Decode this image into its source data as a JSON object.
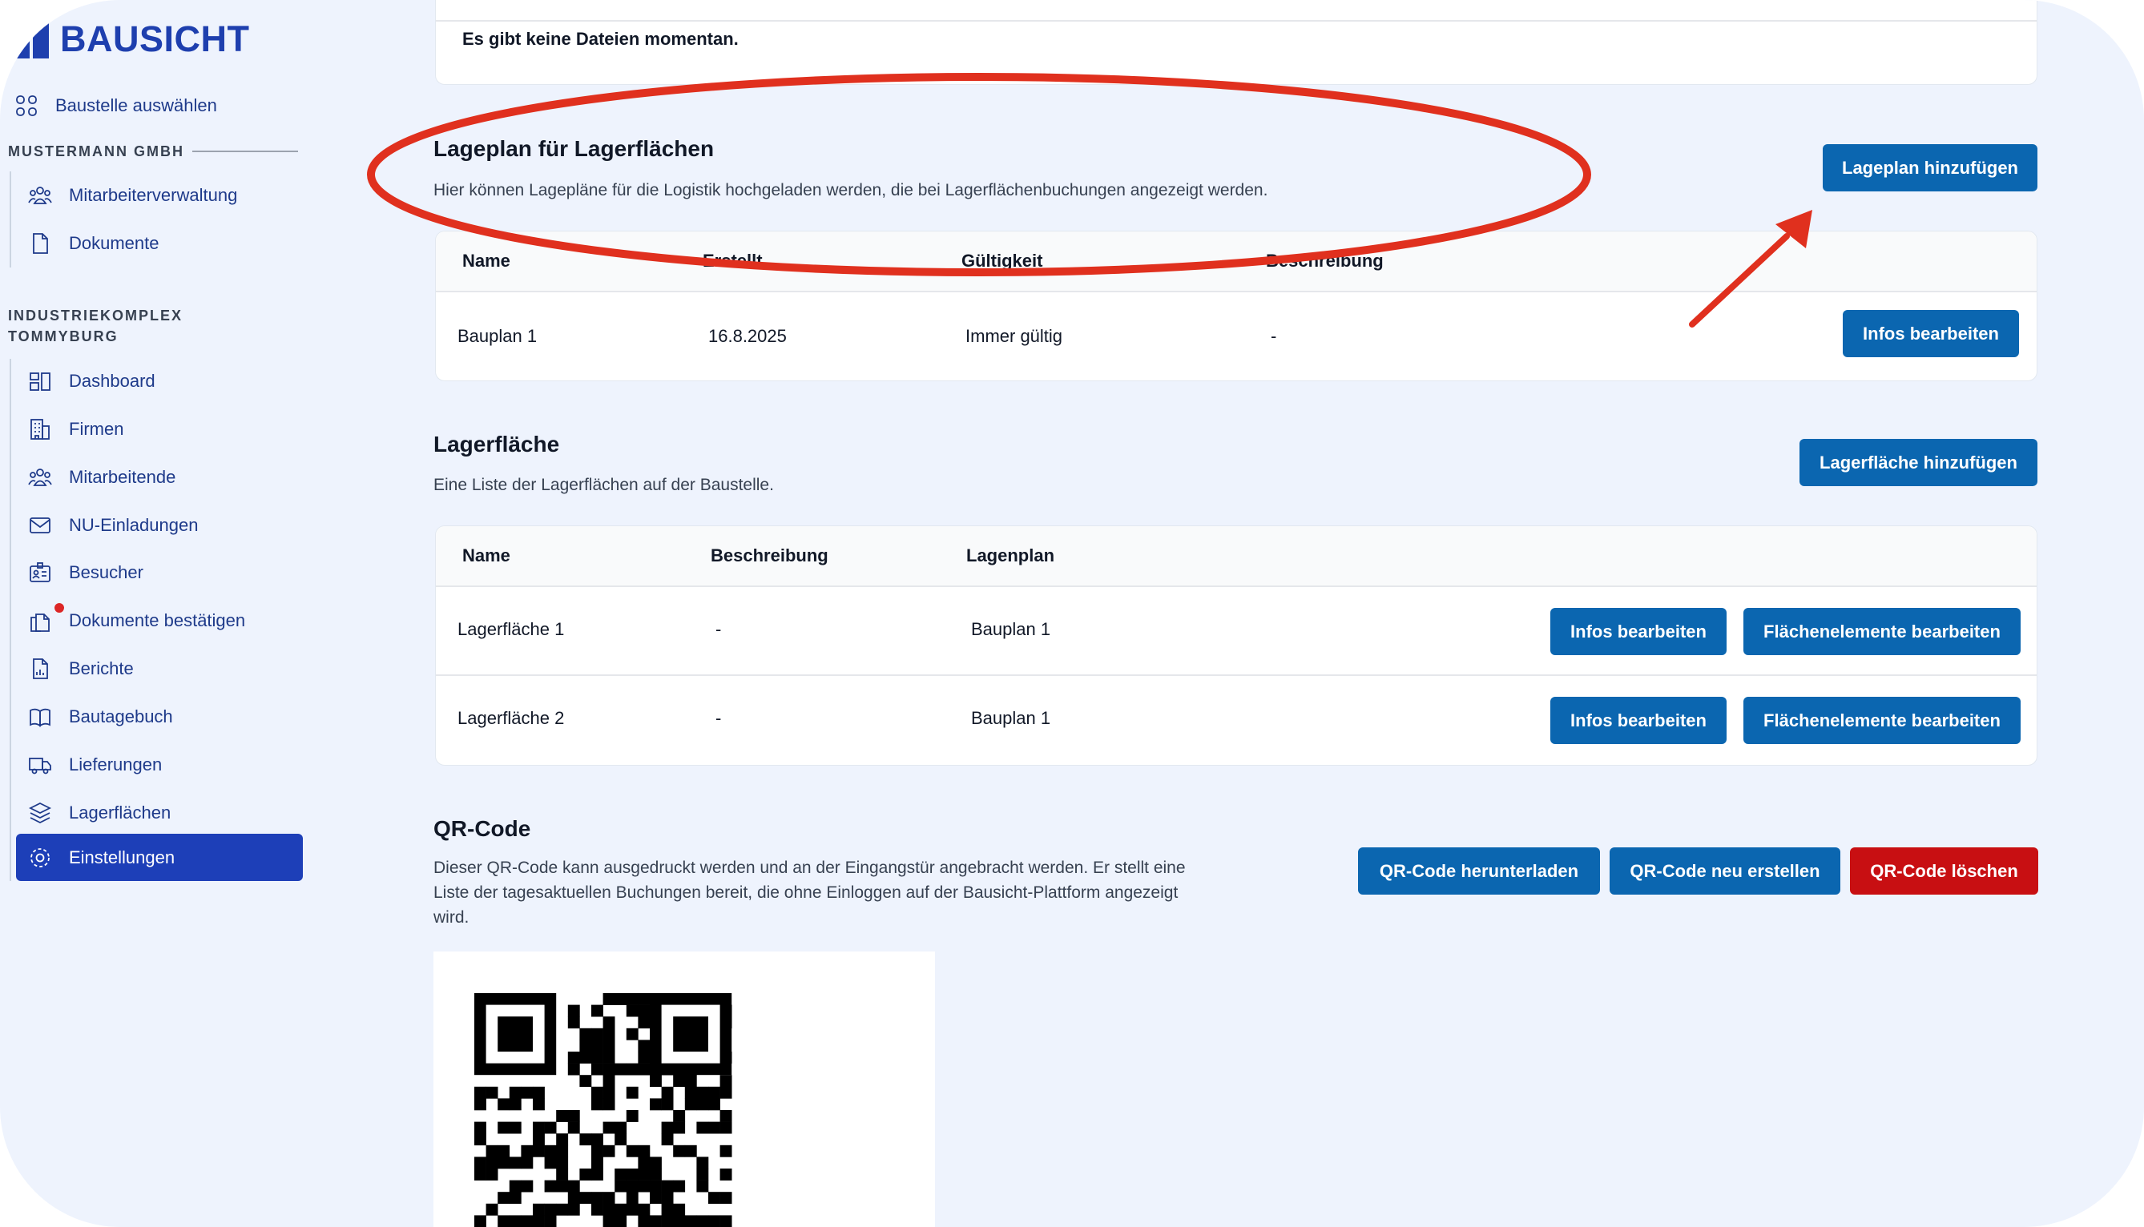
{
  "brand": {
    "name": "BAUSICHT",
    "color": "#1e3fae"
  },
  "sidebar": {
    "choose_site": {
      "label": "Baustelle auswählen",
      "icon": "grid-icon"
    },
    "org_label": "MUSTERMANN GMBH",
    "org_items": [
      {
        "label": "Mitarbeiterverwaltung",
        "icon": "users-icon"
      },
      {
        "label": "Dokumente",
        "icon": "document-icon"
      }
    ],
    "site_label_line1": "INDUSTRIEKOMPLEX",
    "site_label_line2": "TOMMYBURG",
    "site_items": [
      {
        "label": "Dashboard",
        "icon": "dashboard-icon"
      },
      {
        "label": "Firmen",
        "icon": "building-icon"
      },
      {
        "label": "Mitarbeitende",
        "icon": "users-icon"
      },
      {
        "label": "NU-Einladungen",
        "icon": "mail-icon"
      },
      {
        "label": "Besucher",
        "icon": "id-badge-icon"
      },
      {
        "label": "Dokumente bestätigen",
        "icon": "documents-icon"
      },
      {
        "label": "Berichte",
        "icon": "report-icon"
      },
      {
        "label": "Bautagebuch",
        "icon": "book-icon"
      },
      {
        "label": "Lieferungen",
        "icon": "truck-icon"
      },
      {
        "label": "Lagerflächen",
        "icon": "layers-icon"
      },
      {
        "label": "Einstellungen",
        "icon": "gear-icon",
        "active": true
      }
    ]
  },
  "files_card": {
    "empty_text": "Es gibt keine Dateien momentan."
  },
  "lageplan": {
    "title": "Lageplan für Lagerflächen",
    "description": "Hier können Lagepläne für die Logistik hochgeladen werden, die bei Lagerflächenbuchungen angezeigt werden.",
    "add_button": "Lageplan hinzufügen",
    "columns": [
      "Name",
      "Erstellt",
      "Gültigkeit",
      "Beschreibung"
    ],
    "rows": [
      {
        "name": "Bauplan 1",
        "created": "16.8.2025",
        "validity": "Immer gültig",
        "description": "-",
        "edit_button": "Infos bearbeiten"
      }
    ]
  },
  "lagerflaeche": {
    "title": "Lagerfläche",
    "description": "Eine Liste der Lagerflächen auf der Baustelle.",
    "add_button": "Lagerfläche hinzufügen",
    "columns": [
      "Name",
      "Beschreibung",
      "Lagenplan"
    ],
    "rows": [
      {
        "name": "Lagerfläche 1",
        "description": "-",
        "plan": "Bauplan 1",
        "edit_button": "Infos bearbeiten",
        "elements_button": "Flächenelemente bearbeiten"
      },
      {
        "name": "Lagerfläche 2",
        "description": "-",
        "plan": "Bauplan 1",
        "edit_button": "Infos bearbeiten",
        "elements_button": "Flächenelemente bearbeiten"
      }
    ]
  },
  "qr": {
    "title": "QR-Code",
    "description_line1": "Dieser QR-Code kann ausgedruckt werden und an der Eingangstür angebracht werden. Er stellt eine",
    "description_line2": "Liste der tagesaktuellen Buchungen bereit, die ohne Einloggen auf der Bausicht-Plattform angezeigt",
    "description_line3": "wird.",
    "download_button": "QR-Code herunterladen",
    "regenerate_button": "QR-Code neu erstellen",
    "delete_button": "QR-Code löschen"
  },
  "colors": {
    "primary_button": "#0b66b0",
    "danger_button": "#c80f12",
    "sidebar_active": "#1d3fb8",
    "annotation": "#e0301e"
  }
}
